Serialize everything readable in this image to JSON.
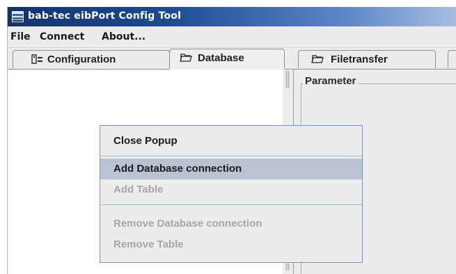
{
  "window": {
    "title": "bab-tec eibPort Config Tool",
    "title_gradient": [
      "#12336e",
      "#a8bee0"
    ]
  },
  "menubar": {
    "items": [
      {
        "label": "File"
      },
      {
        "label": "Connect"
      },
      {
        "label": "About..."
      }
    ]
  },
  "tabs": [
    {
      "label": "Configuration",
      "icon": "configuration-icon",
      "active": false
    },
    {
      "label": "Database",
      "icon": "folder-icon",
      "active": true
    },
    {
      "label": "Filetransfer",
      "icon": "folder-icon",
      "active": false
    }
  ],
  "parameter_panel": {
    "title": "Parameter"
  },
  "context_menu": {
    "items": [
      {
        "label": "Close Popup",
        "enabled": true,
        "highlighted": false
      },
      {
        "label": "Add Database connection",
        "enabled": true,
        "highlighted": true
      },
      {
        "label": "Add Table",
        "enabled": false,
        "highlighted": false
      },
      {
        "label": "Remove Database connection",
        "enabled": false,
        "highlighted": false
      },
      {
        "label": "Remove Table",
        "enabled": false,
        "highlighted": false
      }
    ],
    "highlight_color": "#b9c3d4",
    "disabled_color": "#a6a6a6"
  }
}
